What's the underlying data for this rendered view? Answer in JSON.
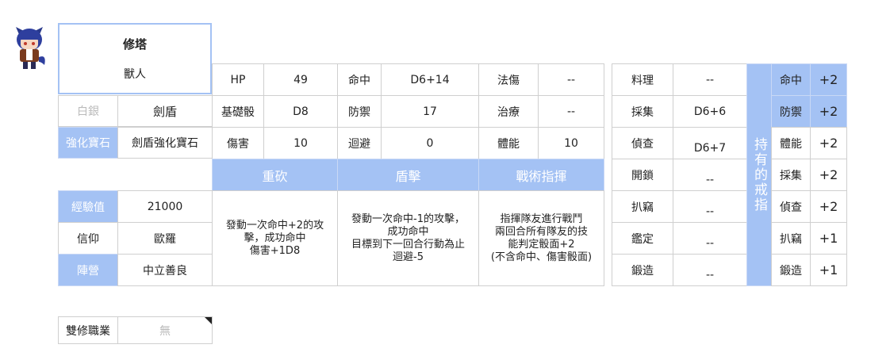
{
  "character": {
    "name": "修塔",
    "race": "獸人"
  },
  "rank": {
    "label": "白銀",
    "class": "劍盾"
  },
  "gem": {
    "label": "強化寶石",
    "value": "劍盾強化寶石"
  },
  "stats": {
    "hp": {
      "label": "HP",
      "value": "49"
    },
    "base_die": {
      "label": "基礎骰",
      "value": "D8"
    },
    "damage": {
      "label": "傷害",
      "value": "10"
    },
    "hit": {
      "label": "命中",
      "value": "D6+14"
    },
    "defense": {
      "label": "防禦",
      "value": "17"
    },
    "evade": {
      "label": "迴避",
      "value": "0"
    },
    "magic_dmg": {
      "label": "法傷",
      "value": "--"
    },
    "heal": {
      "label": "治療",
      "value": "--"
    },
    "stamina": {
      "label": "體能",
      "value": "10"
    }
  },
  "skills": [
    {
      "name": "重砍",
      "desc": "發動一次命中+2的攻\n擊，成功命中\n傷害+1D8"
    },
    {
      "name": "盾擊",
      "desc": "發動一次命中-1的攻擊，\n成功命中\n目標到下一回合行動為止\n迴避-5"
    },
    {
      "name": "戰術指揮",
      "desc": "指揮隊友進行戰鬥\n兩回合所有隊友的技\n能判定骰面+2\n(不含命中、傷害骰面)"
    }
  ],
  "exp": {
    "label": "經驗值",
    "value": "21000"
  },
  "faith": {
    "label": "信仰",
    "value": "歐羅"
  },
  "camp": {
    "label": "陣營",
    "value": "中立善良"
  },
  "dual_class": {
    "label": "雙修職業",
    "value": "無"
  },
  "life_skills": [
    {
      "label": "料理",
      "value": "--"
    },
    {
      "label": "採集",
      "value": "D6+6"
    },
    {
      "label": "偵查",
      "value": "D6+7"
    },
    {
      "label": "開鎖",
      "value": "--"
    },
    {
      "label": "扒竊",
      "value": "--"
    },
    {
      "label": "鑑定",
      "value": "--"
    },
    {
      "label": "鍛造",
      "value": "--"
    }
  ],
  "rings": {
    "title": "持有的戒指",
    "items": [
      {
        "label": "命中",
        "value": "+2"
      },
      {
        "label": "防禦",
        "value": "+2"
      },
      {
        "label": "體能",
        "value": "+2"
      },
      {
        "label": "採集",
        "value": "+2"
      },
      {
        "label": "偵查",
        "value": "+2"
      },
      {
        "label": "扒竊",
        "value": "+1"
      },
      {
        "label": "鍛造",
        "value": "+1"
      }
    ]
  },
  "colors": {
    "accent": "#a4c2f4",
    "border": "#cfcfcf",
    "muted": "#bbbbbb"
  },
  "icons": {
    "avatar": "wolf-girl-avatar-icon"
  }
}
